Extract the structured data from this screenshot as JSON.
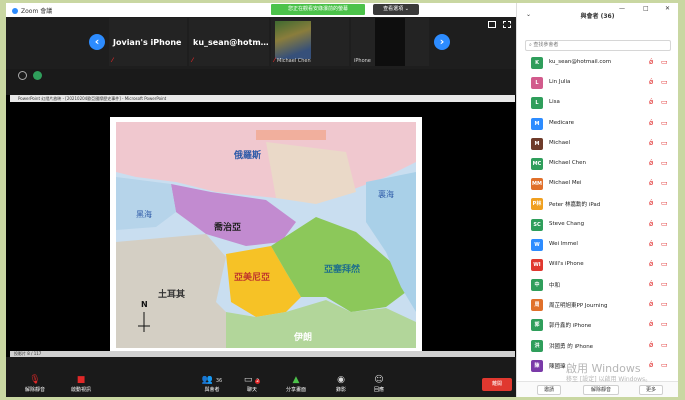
{
  "window": {
    "title": "Zoom 會議"
  },
  "banner": {
    "share_text": "您正在觀看安綠瀑前的螢幕",
    "view_options": "查看選項 ⌄"
  },
  "tiles": [
    {
      "name": "Jovian's iPhone",
      "foot": ""
    },
    {
      "name": "ku_sean@hotm…",
      "foot": ""
    },
    {
      "name": "",
      "foot": "Michael Chen"
    },
    {
      "name": "",
      "foot": "iPhone"
    }
  ],
  "ppt": {
    "title": "PowerPoint 幻燈片放映 - [20210204歐亞國際歷史事件] - Microsoft PowerPoint",
    "status": "投影片 8 / 117"
  },
  "map_labels": {
    "russia": "俄羅斯",
    "georgia": "喬治亞",
    "armenia": "亞美尼亞",
    "azerbaijan": "亞塞拜然",
    "turkey": "土耳其",
    "iran": "伊朗",
    "black_sea": "黑海",
    "caspian_sea": "裏海",
    "north": "N"
  },
  "toolbar": {
    "unmute": "解除靜音",
    "video": "啟動視訊",
    "participants": "與會者",
    "participants_count": "36",
    "chat": "聊天",
    "chat_badge": "2",
    "share": "分享畫面",
    "record": "錄影",
    "reactions": "回應",
    "end": "離開"
  },
  "panel": {
    "title": "與會者 (36)",
    "search_placeholder": "查找參會者",
    "participants": [
      {
        "initials": "K",
        "name": "ku_sean@hotmail.com",
        "color": "#2f9e5b"
      },
      {
        "initials": "L",
        "name": "Lin Julia",
        "color": "#d25b8c"
      },
      {
        "initials": "L",
        "name": "Lisa",
        "color": "#2f9e5b"
      },
      {
        "initials": "M",
        "name": "Medicare",
        "color": "#2d8cff"
      },
      {
        "initials": "M",
        "name": "Michael",
        "color": "#6e3b2a"
      },
      {
        "initials": "MC",
        "name": "Michael Chen",
        "color": "#2f9e5b"
      },
      {
        "initials": "MM",
        "name": "Michael Mei",
        "color": "#e0702a"
      },
      {
        "initials": "P林",
        "name": "Peter 林嘉勳的 iPad",
        "color": "#f0a020"
      },
      {
        "initials": "SC",
        "name": "Steve Chang",
        "color": "#2f9e5b"
      },
      {
        "initials": "W",
        "name": "Wei lmmel",
        "color": "#2d8cff"
      },
      {
        "initials": "WI",
        "name": "Will's iPhone",
        "color": "#e0382f"
      },
      {
        "initials": "中",
        "name": "中和",
        "color": "#2f9e5b"
      },
      {
        "initials": "周",
        "name": "周芷明旭東PP Journing",
        "color": "#e0702a"
      },
      {
        "initials": "郭",
        "name": "郭丹鑫的 iPhone",
        "color": "#2f9e5b"
      },
      {
        "initials": "洪",
        "name": "洪國勇 的 iPhone",
        "color": "#2f9e5b"
      },
      {
        "initials": "陳",
        "name": "陳國瑋",
        "color": "#7a3aa8"
      }
    ],
    "invite": "邀請",
    "mute_all": "解除靜音",
    "more": "更多"
  },
  "watermark": {
    "main": "啟用 Windows",
    "sub": "移至 [設定] 以啟用 Windows。"
  },
  "colors": {
    "zoom_blue": "#2d8cff",
    "banner_green": "#4cc24a",
    "end_red": "#e0382f"
  }
}
